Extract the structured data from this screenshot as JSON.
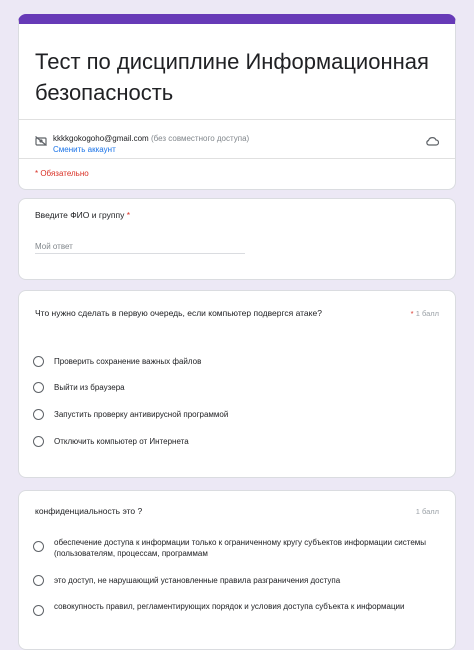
{
  "form": {
    "title": "Тест по дисциплине Информационная безопасность",
    "account_email": "kkkkgokogoho@gmail.com",
    "account_note": "(без совместного доступа)",
    "switch_account": "Сменить аккаунт",
    "required_note": "* Обязательно",
    "accent_color": "#673ab7"
  },
  "icons": {
    "account": "account-crossed-icon",
    "cloud": "cloud-icon"
  },
  "questions": [
    {
      "text": "Введите ФИО и группу",
      "required_mark": "*",
      "input_placeholder": "Мой ответ"
    },
    {
      "text": "Что нужно сделать в первую очередь, если компьютер подвергся атаке?",
      "required_mark": "*",
      "points": "1 балл",
      "options": [
        "Проверить сохранение важных файлов",
        "Выйти из браузера",
        "Запустить проверку антивирусной программой",
        "Отключить компьютер от Интернета"
      ]
    },
    {
      "text": "конфиденциальность это ?",
      "points": "1 балл",
      "options": [
        "обеспечение доступа к информации только к ограниченному кругу субъектов информации системы (пользователям, процессам, программам",
        "это доступ, не нарушающий установленные правила разграничения доступа",
        "совокупность правил, регламентирующих порядок и условия доступа субъекта к информации"
      ]
    }
  ]
}
